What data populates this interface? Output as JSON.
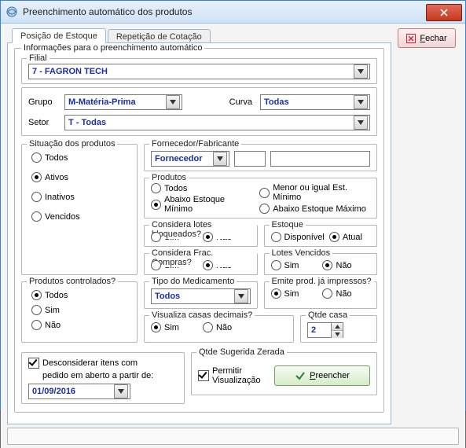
{
  "window": {
    "title": "Preenchimento automático dos produtos"
  },
  "buttons": {
    "fechar": "Fechar",
    "preencher": "Preencher"
  },
  "tabs": {
    "posicao": "Posição de Estoque",
    "repeticao": "Repetição de Cotação"
  },
  "info_group_legend": "Informações para o preenchimento automático",
  "filial": {
    "label": "Filial",
    "value": "7 - FAGRON TECH"
  },
  "grupo": {
    "label": "Grupo",
    "value": "M-Matéria-Prima"
  },
  "curva": {
    "label": "Curva",
    "value": "Todas"
  },
  "setor": {
    "label": "Setor",
    "value": "T - Todas"
  },
  "situacao": {
    "legend": "Situação dos produtos",
    "opt_todos": "Todos",
    "opt_ativos": "Ativos",
    "opt_inativos": "Inativos",
    "opt_vencidos": "Vencidos",
    "selected": "ativos"
  },
  "fornecedor": {
    "legend": "Fornecedor/Fabricante",
    "value": "Fornecedor"
  },
  "produtos": {
    "legend": "Produtos",
    "opt_todos": "Todos",
    "opt_abaixo_min": "Abaixo Estoque Mínimo",
    "opt_menor_igual": "Menor ou igual Est. Mínimo",
    "opt_abaixo_max": "Abaixo Estoque Máximo",
    "selected": "abaixo_min"
  },
  "lotes_bloq": {
    "legend": "Considera lotes bloqueados?",
    "opt_sim": "Sim",
    "opt_nao": "Não",
    "selected": "nao"
  },
  "estoque": {
    "legend": "Estoque",
    "opt_disp": "Disponível",
    "opt_atual": "Atual",
    "selected": "atual"
  },
  "frac_compras": {
    "legend": "Considera Frac. Compras?",
    "opt_sim": "Sim",
    "opt_nao": "Não",
    "selected": "nao"
  },
  "lotes_venc": {
    "legend": "Lotes Vencidos",
    "opt_sim": "Sim",
    "opt_nao": "Não",
    "selected": "nao"
  },
  "prod_controlados": {
    "legend": "Produtos controlados?",
    "opt_todos": "Todos",
    "opt_sim": "Sim",
    "opt_nao": "Não",
    "selected": "todos"
  },
  "tipo_med": {
    "legend": "Tipo do Medicamento",
    "value": "Todos"
  },
  "emite_impressos": {
    "legend": "Emite prod. já impressos?",
    "opt_sim": "Sim",
    "opt_nao": "Não",
    "selected": "sim"
  },
  "visualiza_decimais": {
    "legend": "Visualiza casas decimais?",
    "opt_sim": "Sim",
    "opt_nao": "Não",
    "selected": "sim"
  },
  "qtde_casa": {
    "legend": "Qtde casa",
    "value": "2"
  },
  "qtde_sugerida": {
    "legend": "Qtde Sugerida Zerada",
    "permitir": "Permitir Visualização",
    "checked": true
  },
  "desconsiderar": {
    "label1": "Desconsiderar itens com",
    "label2": "pedido em aberto a partir de:",
    "date": "01/09/2016",
    "checked": true
  }
}
